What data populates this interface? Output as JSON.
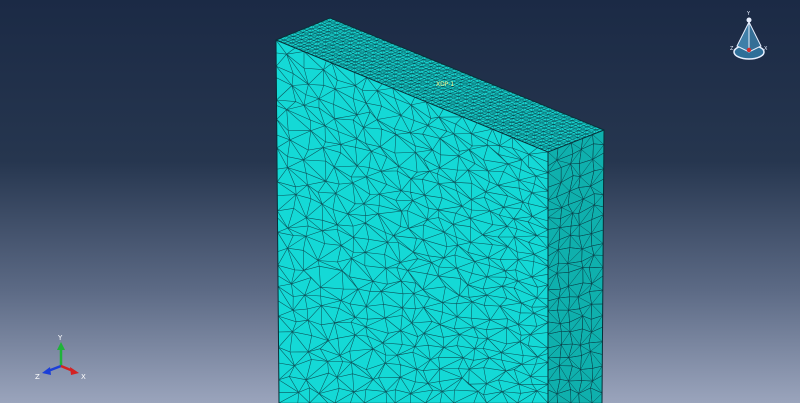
{
  "viewport": {
    "background_top": "#1b2a45",
    "background_bottom": "#9aa4bc"
  },
  "model": {
    "front_face_color": "#14d9d6",
    "side_face_color": "#0fb0ad",
    "top_face_color": "#16d0cc",
    "mesh_line_color": "#0a3b44",
    "label_color": "#f2f28a",
    "set_label": "XDP-1"
  },
  "triad": {
    "y_label": "Y",
    "z_label": "Z",
    "x_label": "X",
    "y_color": "#1fb33a",
    "z_color": "#1b3fd8",
    "x_color": "#d42222"
  },
  "view_cube": {
    "top_label": "Y",
    "left_label": "Z",
    "right_label": "X",
    "face_color": "#3f7fa8",
    "edge_color": "#e8f0ff",
    "center_color": "#d92a2a"
  }
}
